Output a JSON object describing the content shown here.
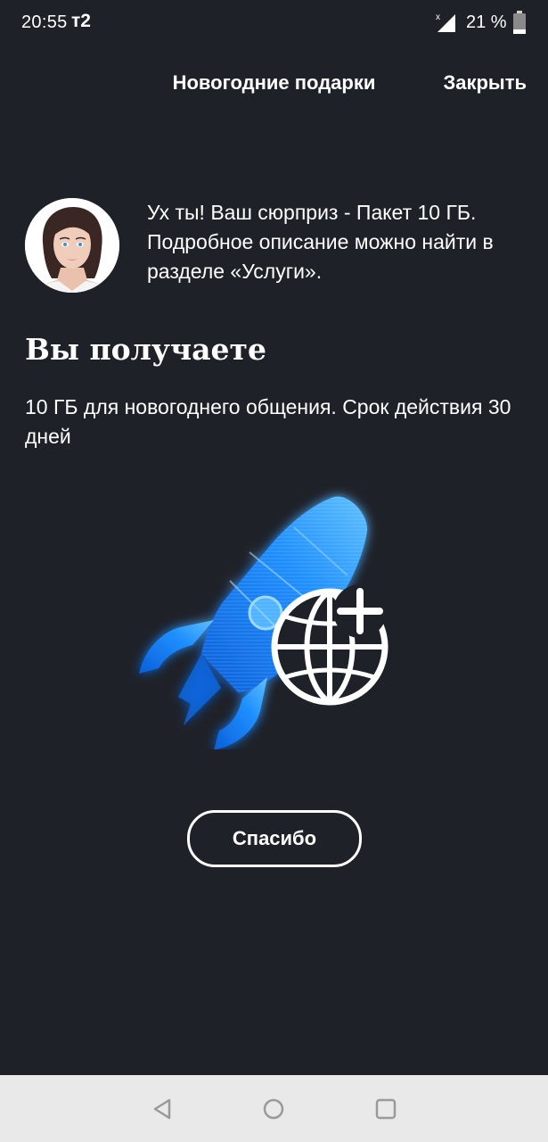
{
  "status_bar": {
    "time": "20:55",
    "carrier": "т2",
    "battery_percent": "21 %",
    "battery_level": 0.21
  },
  "header": {
    "title": "Новогодние подарки",
    "close_label": "Закрыть"
  },
  "message": {
    "text": "Ух ты! Ваш сюрприз - Пакет 10 ГБ. Подробное описание можно найти в разделе «Услуги»."
  },
  "offer": {
    "title": "Вы получаете",
    "description": "10 ГБ для новогоднего общения. Срок действия 30 дней"
  },
  "illustration": {
    "icons": [
      "rocket-icon",
      "globe-plus-icon"
    ],
    "accent_color": "#1e8fff"
  },
  "actions": {
    "thanks_label": "Спасибо"
  },
  "nav_bar": {
    "icons": [
      "back-icon",
      "home-icon",
      "recents-icon"
    ]
  },
  "colors": {
    "background": "#1f2128",
    "text": "#ffffff",
    "nav_background": "#e9e9e9"
  }
}
